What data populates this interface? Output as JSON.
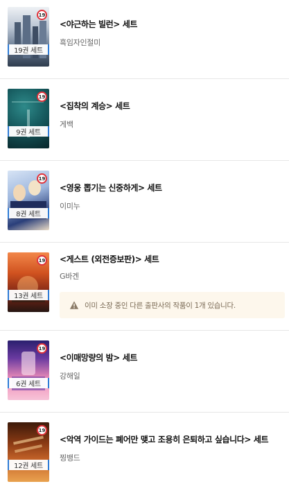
{
  "items": [
    {
      "title": "<야근하는 빌런> 세트",
      "author": "흑임자인절미",
      "count_label": "19권 세트",
      "age_rating": "19",
      "cover_colors": [
        "#e9edf2",
        "#7d8fa6",
        "#3b4a5e"
      ]
    },
    {
      "title": "<집착의 계승> 세트",
      "author": "게백",
      "count_label": "9권 세트",
      "age_rating": "19",
      "cover_colors": [
        "#0f4a4f",
        "#1f6f73",
        "#0a2b30"
      ]
    },
    {
      "title": "<영웅 뽑기는 신중하게> 세트",
      "author": "이미누",
      "count_label": "8권 세트",
      "age_rating": "19",
      "cover_colors": [
        "#c7d8f0",
        "#2a3f7a",
        "#f1e6d6"
      ]
    },
    {
      "title": "<게스트 (외전증보판)> 세트",
      "author": "G바겐",
      "count_label": "13권 세트",
      "age_rating": "19",
      "cover_colors": [
        "#e0652a",
        "#7a2414",
        "#2b1a14"
      ],
      "notice": {
        "text": "이미 소장 중인 다른 출판사의 작품이 1개 있습니다.",
        "icon": "warning-icon"
      }
    },
    {
      "title": "<이매망량의 밤> 세트",
      "author": "강해일",
      "count_label": "6권 세트",
      "age_rating": "19",
      "cover_colors": [
        "#f08fb8",
        "#3a2a8a",
        "#f4b3cf"
      ]
    },
    {
      "title": "<악역 가이드는 폐어만 맺고 조용히 은퇴하고 싶습니다> 세트",
      "author": "찡뱅드",
      "count_label": "12권 세트",
      "age_rating": "19",
      "cover_colors": [
        "#b0541c",
        "#4a1e0c",
        "#e39a45"
      ]
    }
  ],
  "colors": {
    "age_badge_ring": "#e0323a",
    "count_badge_accent": "#2e7bd6",
    "notice_bg": "#fdf7ec",
    "warning": "#8a7a66"
  }
}
